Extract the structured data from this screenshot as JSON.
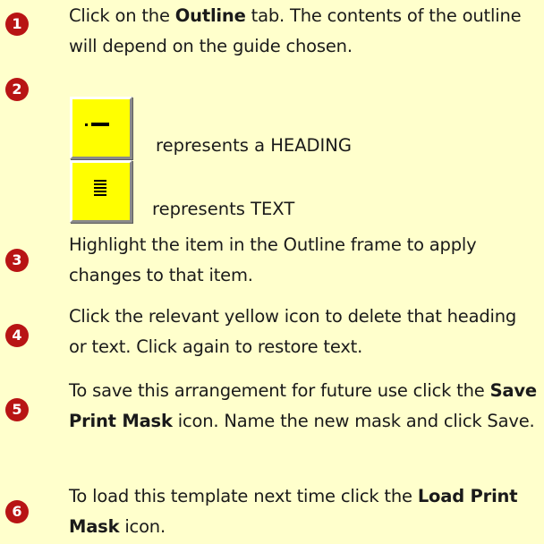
{
  "steps": [
    {
      "number": "1",
      "pre": "Click on the ",
      "bold": "Outline",
      "post": " tab. The contents of the outline will depend on the guide chosen."
    },
    {
      "number": "2",
      "icons": [
        {
          "icon": "heading-icon",
          "label": "represents a HEADING"
        },
        {
          "icon": "text-icon",
          "label": "represents TEXT"
        }
      ]
    },
    {
      "number": "3",
      "text": "Highlight the item in the Outline frame to apply changes to that item."
    },
    {
      "number": "4",
      "text": "Click the relevant yellow icon to delete that heading or text. Click again to restore text."
    },
    {
      "number": "5",
      "pre": "To save this arrangement for future use click the ",
      "bold": "Save Print Mask",
      "post": " icon. Name the new mask and click Save."
    },
    {
      "number": "6",
      "pre": "To load this template next time click the ",
      "bold": "Load Print Mask",
      "post": " icon."
    }
  ],
  "colors": {
    "background": "#ffffcc",
    "bullet": "#b81414",
    "icon_fill": "#ffff00"
  }
}
